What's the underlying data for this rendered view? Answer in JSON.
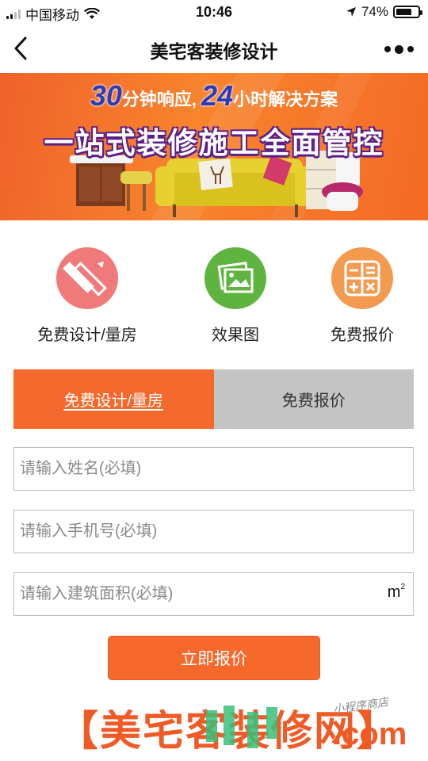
{
  "status_bar": {
    "carrier": "中国移动",
    "time": "10:46",
    "battery_percent": "74%",
    "battery_level": 0.74
  },
  "nav": {
    "title": "美宅客装修设计"
  },
  "banner": {
    "tag_num1": "30",
    "tag_text1": "分钟响应,",
    "tag_num2": "24",
    "tag_text2": "小时解决方案",
    "headline": "一站式装修施工全面管控"
  },
  "features": [
    {
      "label": "免费设计/量房",
      "icon": "ruler-pencil-icon",
      "color": "#f07a79"
    },
    {
      "label": "效果图",
      "icon": "picture-icon",
      "color": "#5fb43f"
    },
    {
      "label": "免费报价",
      "icon": "calculator-icon",
      "color": "#f39a4f"
    }
  ],
  "tabs": [
    {
      "label": "免费设计/量房",
      "active": true
    },
    {
      "label": "免费报价",
      "active": false
    }
  ],
  "form": {
    "name_placeholder": "请输入姓名(必填)",
    "phone_placeholder": "请输入手机号(必填)",
    "area_placeholder": "请输入建筑面积(必填)",
    "area_unit": "m",
    "area_unit_sup": "2",
    "submit_label": "立即报价"
  },
  "footer": {
    "brand_open": "【",
    "brand_name_1": "美宅客",
    "brand_name_2": "装修网",
    "brand_close": "】",
    "domain": ".com",
    "shop_tag": "小程序商店"
  },
  "colors": {
    "accent": "#f5692c",
    "tab_inactive": "#c4c4c4",
    "banner": "#f8842d",
    "headline_outline": "#5a1f8a"
  }
}
